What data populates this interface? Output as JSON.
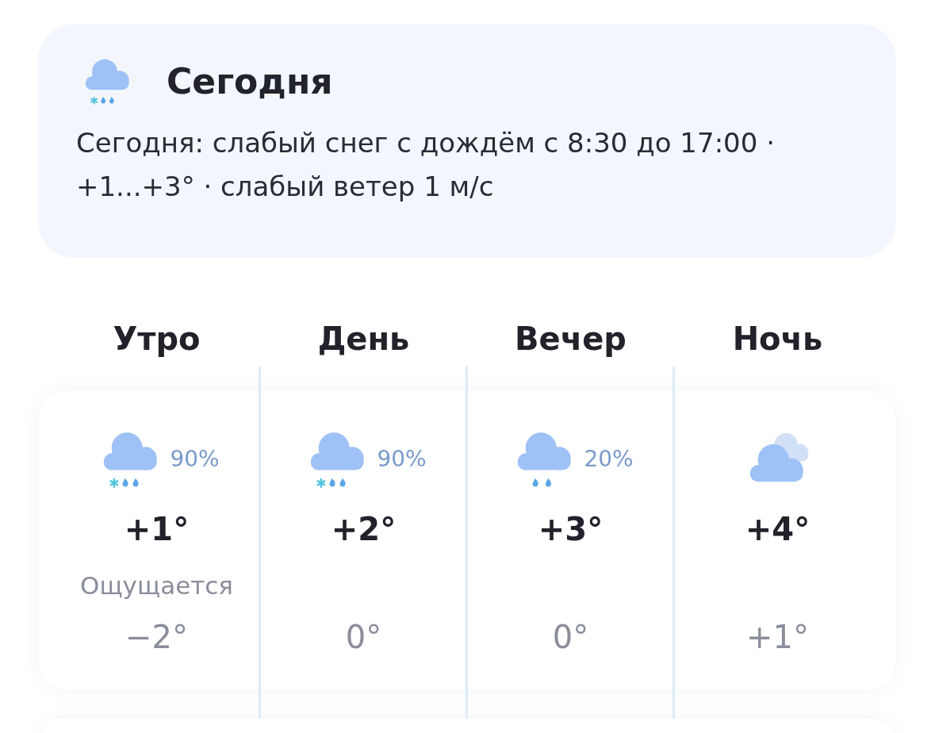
{
  "today": {
    "kind": "snow_rain",
    "title": "Сегодня",
    "summary": "Сегодня: слабый снег с дождём с 8:30 до 17:00 · +1...+3° · слабый ветер 1 м/с"
  },
  "periods": [
    {
      "name": "Утро",
      "kind": "snow_rain",
      "chance": "90%",
      "temp": "+1°",
      "feels_label": "Ощущается",
      "feels": "−2°"
    },
    {
      "name": "День",
      "kind": "snow_rain",
      "chance": "90%",
      "temp": "+2°",
      "feels": "0°"
    },
    {
      "name": "Вечер",
      "kind": "rain",
      "chance": "20%",
      "temp": "+3°",
      "feels": "0°"
    },
    {
      "name": "Ночь",
      "kind": "cloudy",
      "temp": "+4°",
      "feels": "+1°"
    }
  ]
}
